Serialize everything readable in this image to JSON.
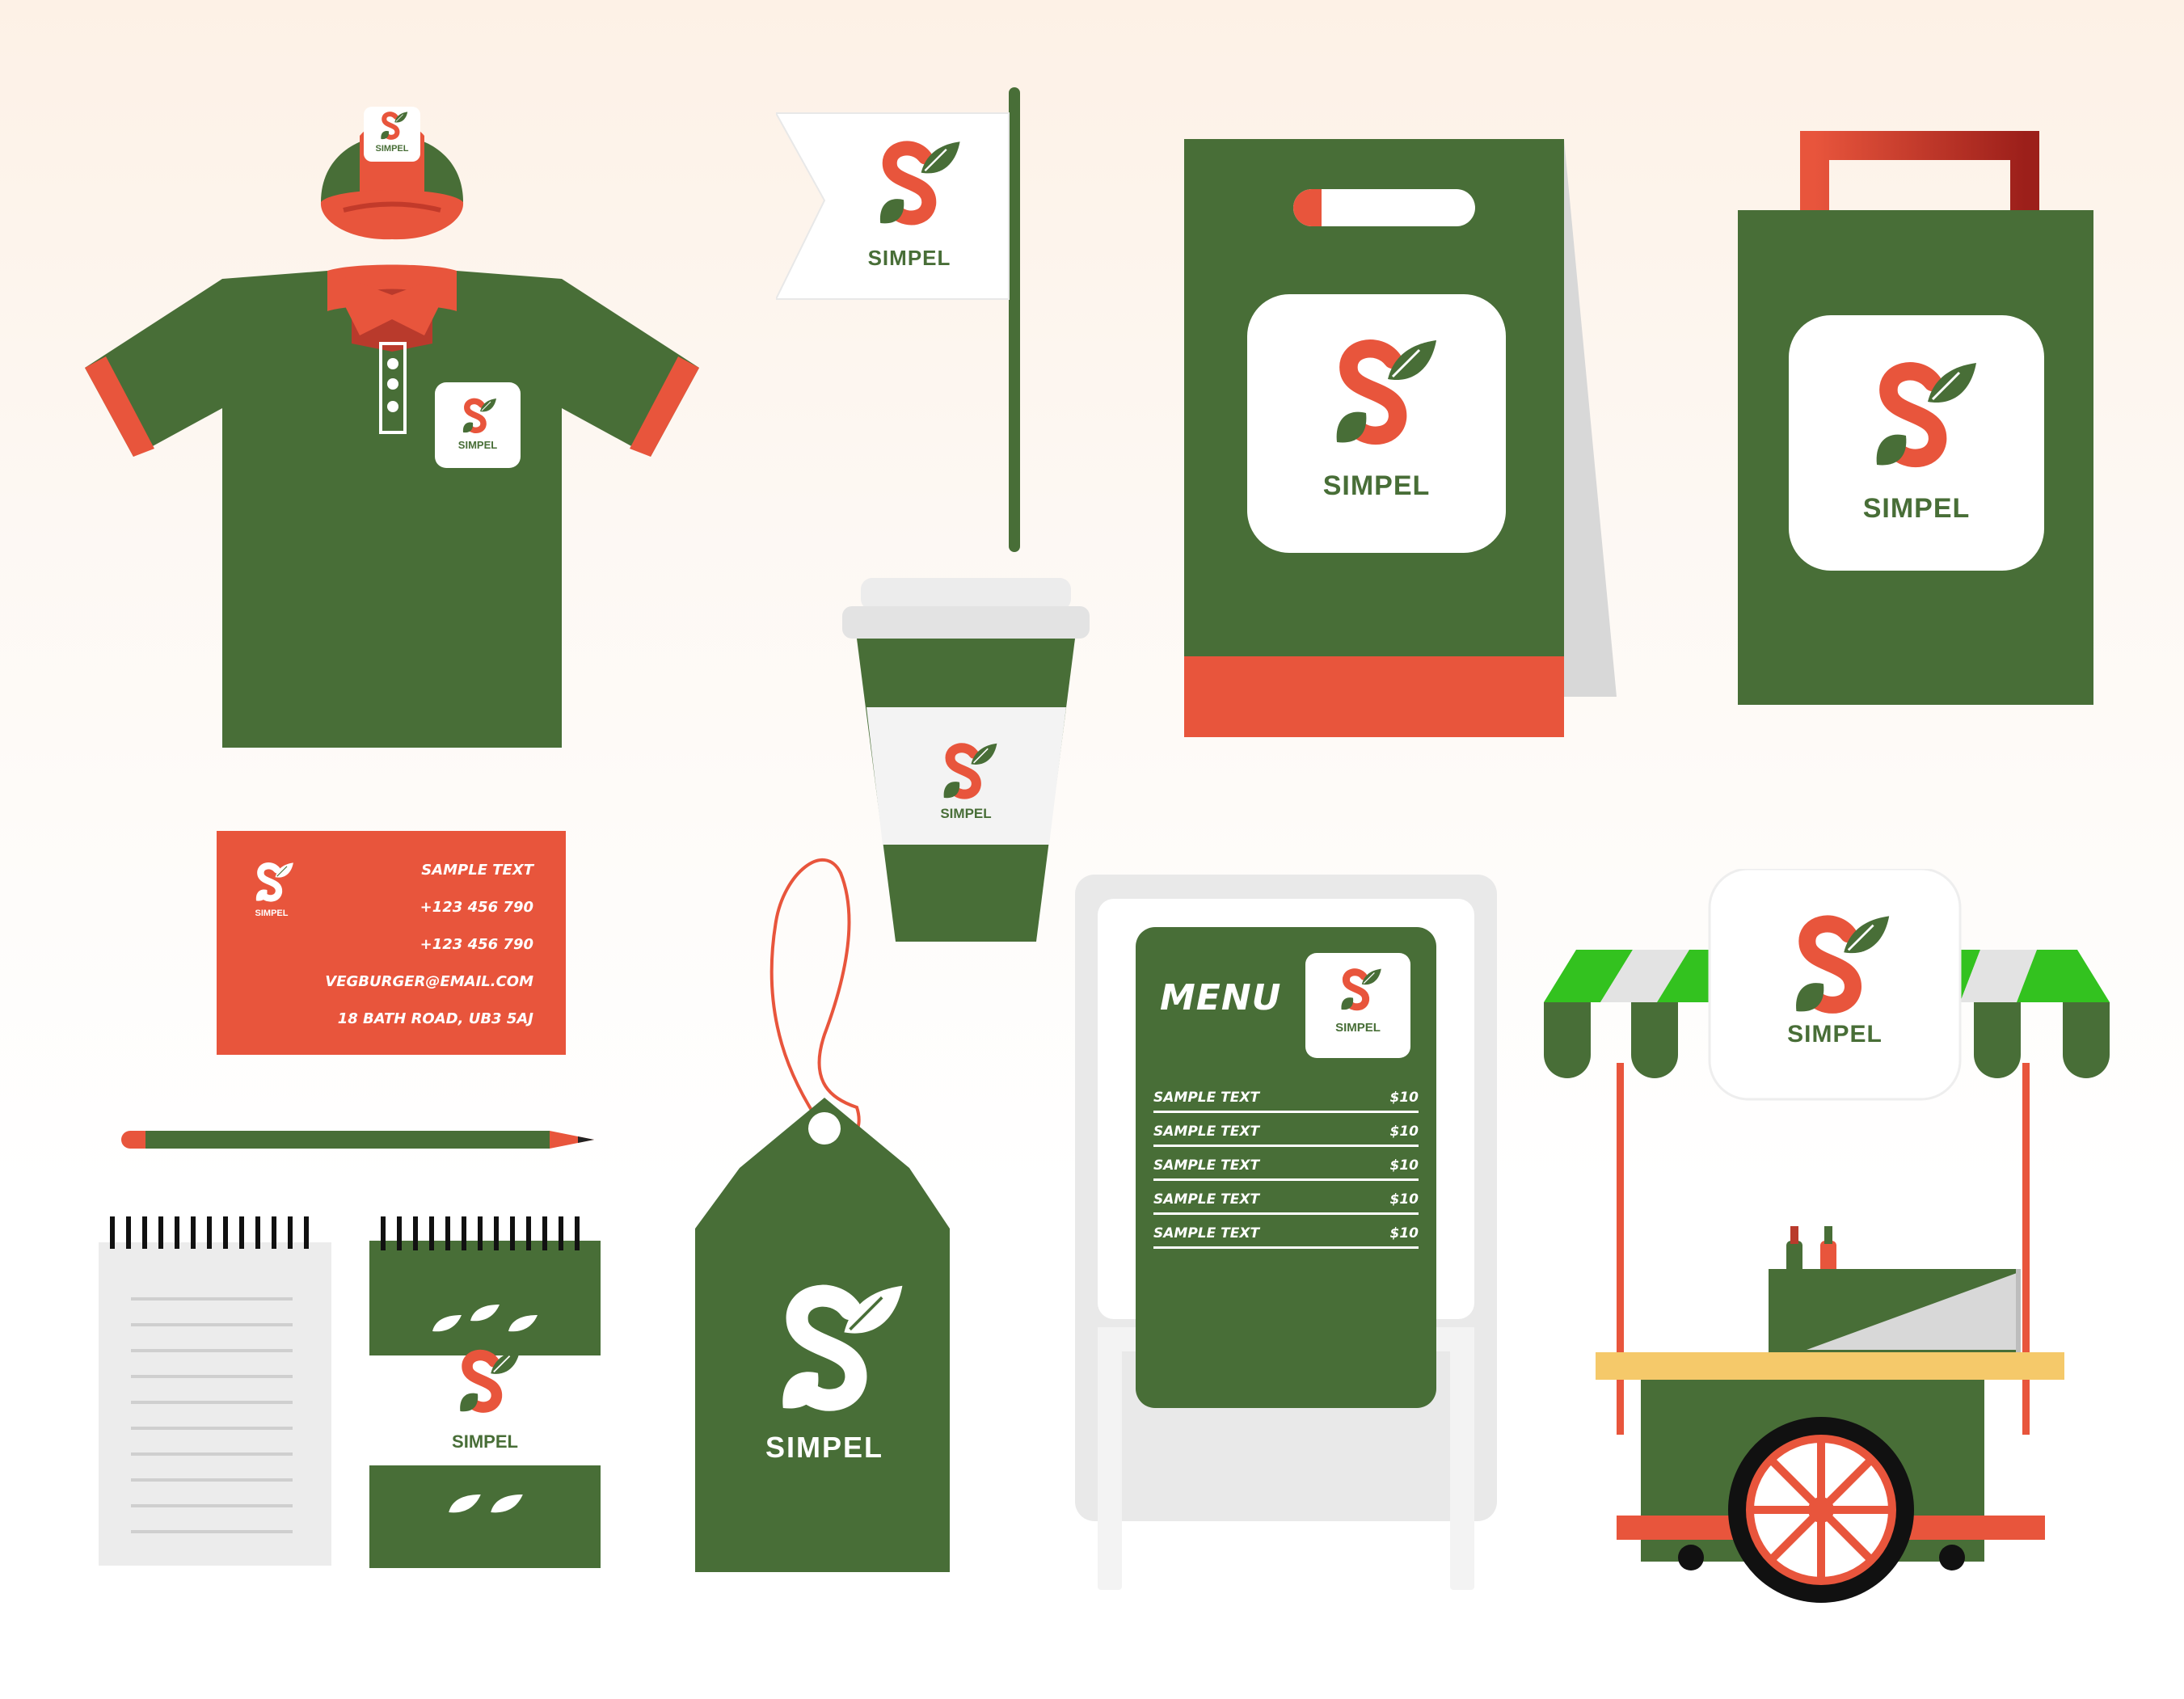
{
  "brand": {
    "name": "SIMPEL",
    "colors": {
      "green": "#486e37",
      "orange": "#e8553c",
      "white": "#ffffff",
      "yellow": "#f5c96a",
      "stripe": "#33c21f"
    }
  },
  "business_card": {
    "lines": [
      "SAMPLE TEXT",
      "+123 456 790",
      "+123 456 790",
      "VEGBURGER@EMAIL.COM",
      "18 BATH ROAD, UB3 5AJ"
    ]
  },
  "menu_board": {
    "title": "MENU",
    "items": [
      {
        "label": "SAMPLE TEXT",
        "price": "$10"
      },
      {
        "label": "SAMPLE TEXT",
        "price": "$10"
      },
      {
        "label": "SAMPLE TEXT",
        "price": "$10"
      },
      {
        "label": "SAMPLE TEXT",
        "price": "$10"
      },
      {
        "label": "SAMPLE TEXT",
        "price": "$10"
      }
    ]
  }
}
